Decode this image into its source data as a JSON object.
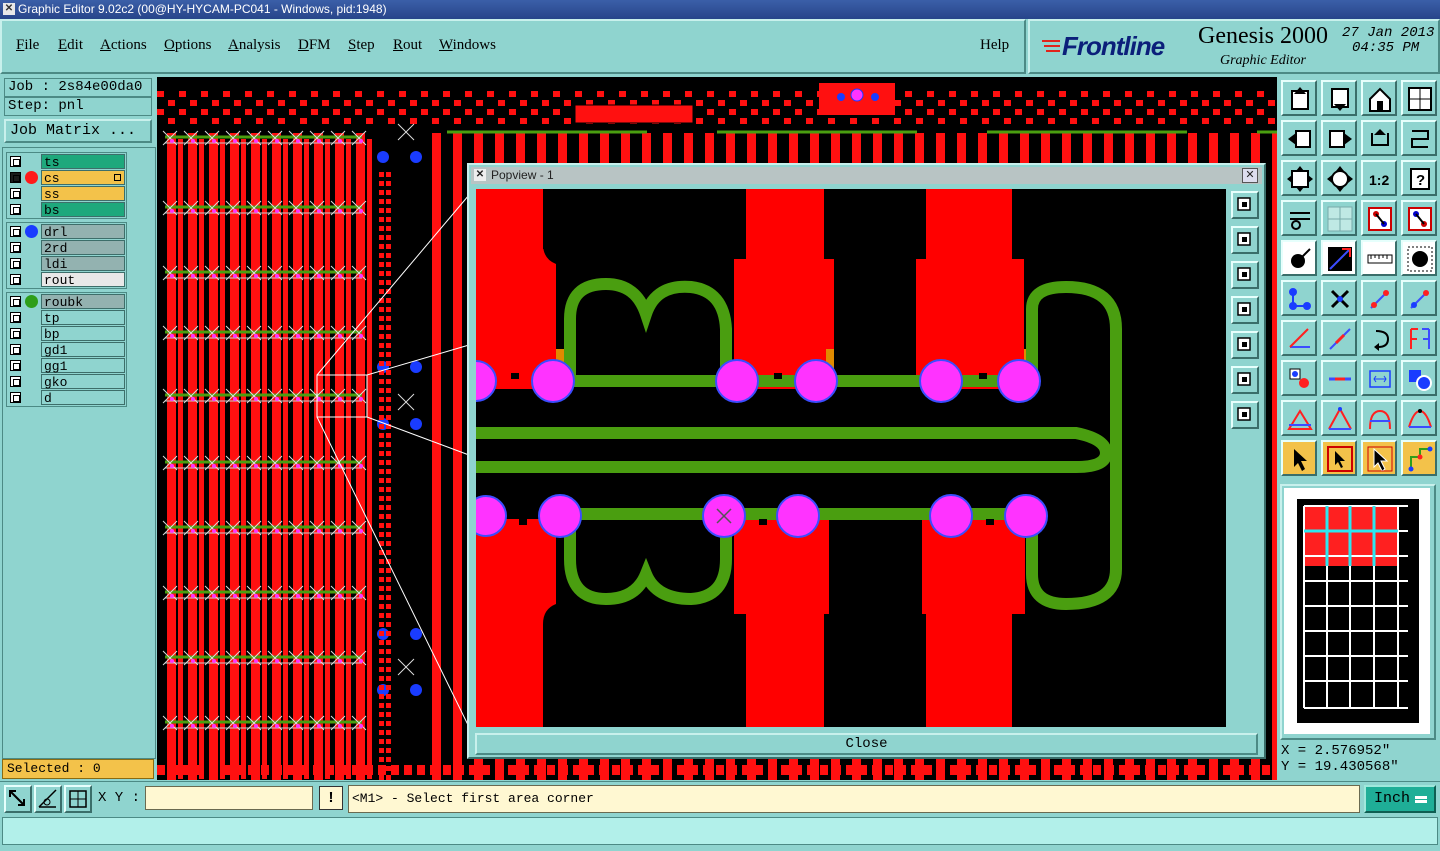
{
  "window": {
    "title": "Graphic Editor 9.02c2 (00@HY-HYCAM-PC041 - Windows, pid:1948)"
  },
  "menu": [
    {
      "label": "File",
      "mn": "F",
      "rest": "ile"
    },
    {
      "label": "Edit",
      "mn": "E",
      "rest": "dit"
    },
    {
      "label": "Actions",
      "mn": "A",
      "rest": "ctions"
    },
    {
      "label": "Options",
      "mn": "O",
      "rest": "ptions"
    },
    {
      "label": "Analysis",
      "mn": "A",
      "rest": "nalysis"
    },
    {
      "label": "DFM",
      "mn": "D",
      "rest": "FM"
    },
    {
      "label": "Step",
      "mn": "S",
      "rest": "tep"
    },
    {
      "label": "Rout",
      "mn": "R",
      "rest": "out"
    },
    {
      "label": "Windows",
      "mn": "W",
      "rest": "indows"
    }
  ],
  "help": "Help",
  "brand": {
    "logo": "Frontline",
    "product": "Genesis 2000",
    "subtitle": "Graphic Editor",
    "date": "27 Jan 2013",
    "time": "04:35 PM"
  },
  "job": "Job : 2s84e00da0",
  "step": "Step: pnl",
  "job_matrix": "Job Matrix ...",
  "layers": {
    "group1": [
      {
        "name": "ts",
        "color": "#1ea87c",
        "checked": false
      },
      {
        "name": "cs",
        "color": "#f3c24a",
        "checked": true,
        "dot": "#ff1a1a"
      },
      {
        "name": "ss",
        "color": "#f3c24a",
        "checked": false
      },
      {
        "name": "bs",
        "color": "#1ea87c",
        "checked": false
      }
    ],
    "group2": [
      {
        "name": "drl",
        "color": "#93b2b0",
        "checked": false,
        "dot": "#1a3cff"
      },
      {
        "name": "2rd",
        "color": "#93b2b0",
        "checked": false
      },
      {
        "name": "ldi",
        "color": "#93b2b0",
        "checked": false
      },
      {
        "name": "rout",
        "color": "#e8e8e8",
        "checked": false
      }
    ],
    "group3": [
      {
        "name": "roubk",
        "color": "#93b2b0",
        "checked": false,
        "dot": "#2e9e1a"
      },
      {
        "name": "tp",
        "color": "#8fd4cf",
        "checked": false
      },
      {
        "name": "bp",
        "color": "#8fd4cf",
        "checked": false
      },
      {
        "name": "gd1",
        "color": "#8fd4cf",
        "checked": false
      },
      {
        "name": "gg1",
        "color": "#8fd4cf",
        "checked": false
      },
      {
        "name": "gko",
        "color": "#8fd4cf",
        "checked": false
      },
      {
        "name": "d",
        "color": "#8fd4cf",
        "checked": false
      }
    ]
  },
  "selected": "Selected : 0",
  "popview": {
    "title": "Popview - 1",
    "close": "Close"
  },
  "coords": {
    "x": "X = 2.576952\"",
    "y": "Y = 19.430568\""
  },
  "bottom": {
    "xy_label": "X Y :",
    "xy_value": "",
    "warn": "!",
    "prompt": "<M1> - Select first area corner",
    "unit": "Inch"
  },
  "colors": {
    "panel": "#8fd4cf",
    "copper": "#ff0000",
    "pad": "#ff33ff",
    "rout": "#4a9e10",
    "drill": "#1a3cff"
  }
}
